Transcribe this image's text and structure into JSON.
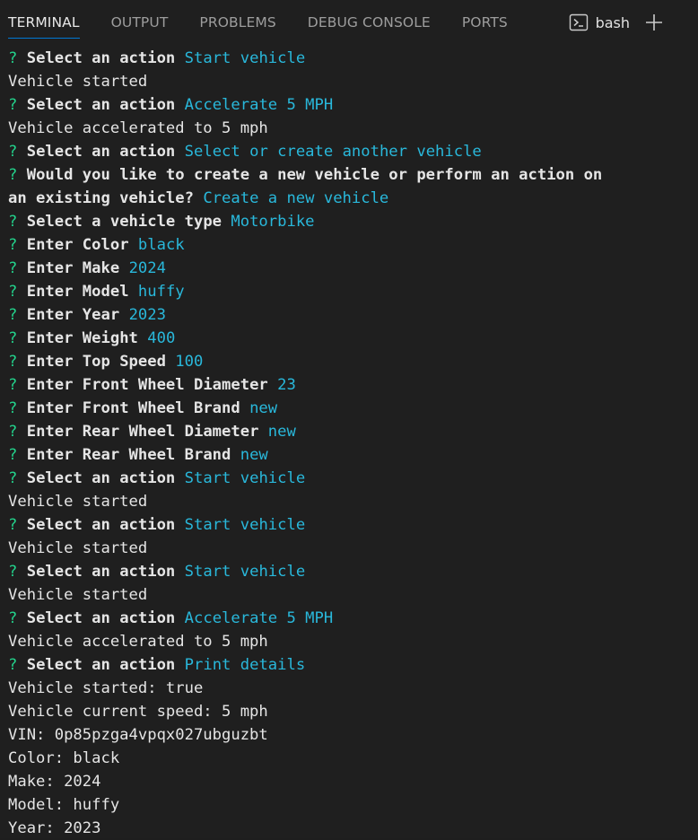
{
  "tabs": [
    {
      "label": "TERMINAL",
      "active": true
    },
    {
      "label": "OUTPUT",
      "active": false
    },
    {
      "label": "PROBLEMS",
      "active": false
    },
    {
      "label": "DEBUG CONSOLE",
      "active": false
    },
    {
      "label": "PORTS",
      "active": false
    }
  ],
  "shell": {
    "label": "bash",
    "icon": "terminal-icon",
    "add_icon": "plus-icon"
  },
  "colors": {
    "background": "#1f1f1f",
    "question_mark": "#23d18b",
    "answer": "#29b8db",
    "prompt_text": "#e5e5e5",
    "tab_active_underline": "#0078d4"
  },
  "terminal": {
    "lines": [
      {
        "kind": "qa",
        "mark": "?",
        "prompt": "Select an action",
        "answer": "Start vehicle"
      },
      {
        "kind": "out",
        "text": "Vehicle started"
      },
      {
        "kind": "qa",
        "mark": "?",
        "prompt": "Select an action",
        "answer": "Accelerate 5 MPH"
      },
      {
        "kind": "out",
        "text": "Vehicle accelerated to 5 mph"
      },
      {
        "kind": "qa",
        "mark": "?",
        "prompt": "Select an action",
        "answer": "Select or create another vehicle"
      },
      {
        "kind": "qa",
        "mark": "?",
        "prompt": "Would you like to create a new vehicle or perform an action on",
        "answer": ""
      },
      {
        "kind": "qa",
        "mark": "",
        "prompt": "an existing vehicle?",
        "answer": "Create a new vehicle"
      },
      {
        "kind": "qa",
        "mark": "?",
        "prompt": "Select a vehicle type",
        "answer": "Motorbike"
      },
      {
        "kind": "qa",
        "mark": "?",
        "prompt": "Enter Color",
        "answer": "black"
      },
      {
        "kind": "qa",
        "mark": "?",
        "prompt": "Enter Make",
        "answer": "2024"
      },
      {
        "kind": "qa",
        "mark": "?",
        "prompt": "Enter Model",
        "answer": "huffy"
      },
      {
        "kind": "qa",
        "mark": "?",
        "prompt": "Enter Year",
        "answer": "2023"
      },
      {
        "kind": "qa",
        "mark": "?",
        "prompt": "Enter Weight",
        "answer": "400"
      },
      {
        "kind": "qa",
        "mark": "?",
        "prompt": "Enter Top Speed",
        "answer": "100"
      },
      {
        "kind": "qa",
        "mark": "?",
        "prompt": "Enter Front Wheel Diameter",
        "answer": "23"
      },
      {
        "kind": "qa",
        "mark": "?",
        "prompt": "Enter Front Wheel Brand",
        "answer": "new"
      },
      {
        "kind": "qa",
        "mark": "?",
        "prompt": "Enter Rear Wheel Diameter",
        "answer": "new"
      },
      {
        "kind": "qa",
        "mark": "?",
        "prompt": "Enter Rear Wheel Brand",
        "answer": "new"
      },
      {
        "kind": "qa",
        "mark": "?",
        "prompt": "Select an action",
        "answer": "Start vehicle"
      },
      {
        "kind": "out",
        "text": "Vehicle started"
      },
      {
        "kind": "qa",
        "mark": "?",
        "prompt": "Select an action",
        "answer": "Start vehicle"
      },
      {
        "kind": "out",
        "text": "Vehicle started"
      },
      {
        "kind": "qa",
        "mark": "?",
        "prompt": "Select an action",
        "answer": "Start vehicle"
      },
      {
        "kind": "out",
        "text": "Vehicle started"
      },
      {
        "kind": "qa",
        "mark": "?",
        "prompt": "Select an action",
        "answer": "Accelerate 5 MPH"
      },
      {
        "kind": "out",
        "text": "Vehicle accelerated to 5 mph"
      },
      {
        "kind": "qa",
        "mark": "?",
        "prompt": "Select an action",
        "answer": "Print details"
      },
      {
        "kind": "out",
        "text": "Vehicle started: true"
      },
      {
        "kind": "out",
        "text": "Vehicle current speed: 5 mph"
      },
      {
        "kind": "out",
        "text": "VIN: 0p85pzga4vpqx027ubguzbt"
      },
      {
        "kind": "out",
        "text": "Color: black"
      },
      {
        "kind": "out",
        "text": "Make: 2024"
      },
      {
        "kind": "out",
        "text": "Model: huffy"
      },
      {
        "kind": "out",
        "text": "Year: 2023"
      }
    ]
  }
}
